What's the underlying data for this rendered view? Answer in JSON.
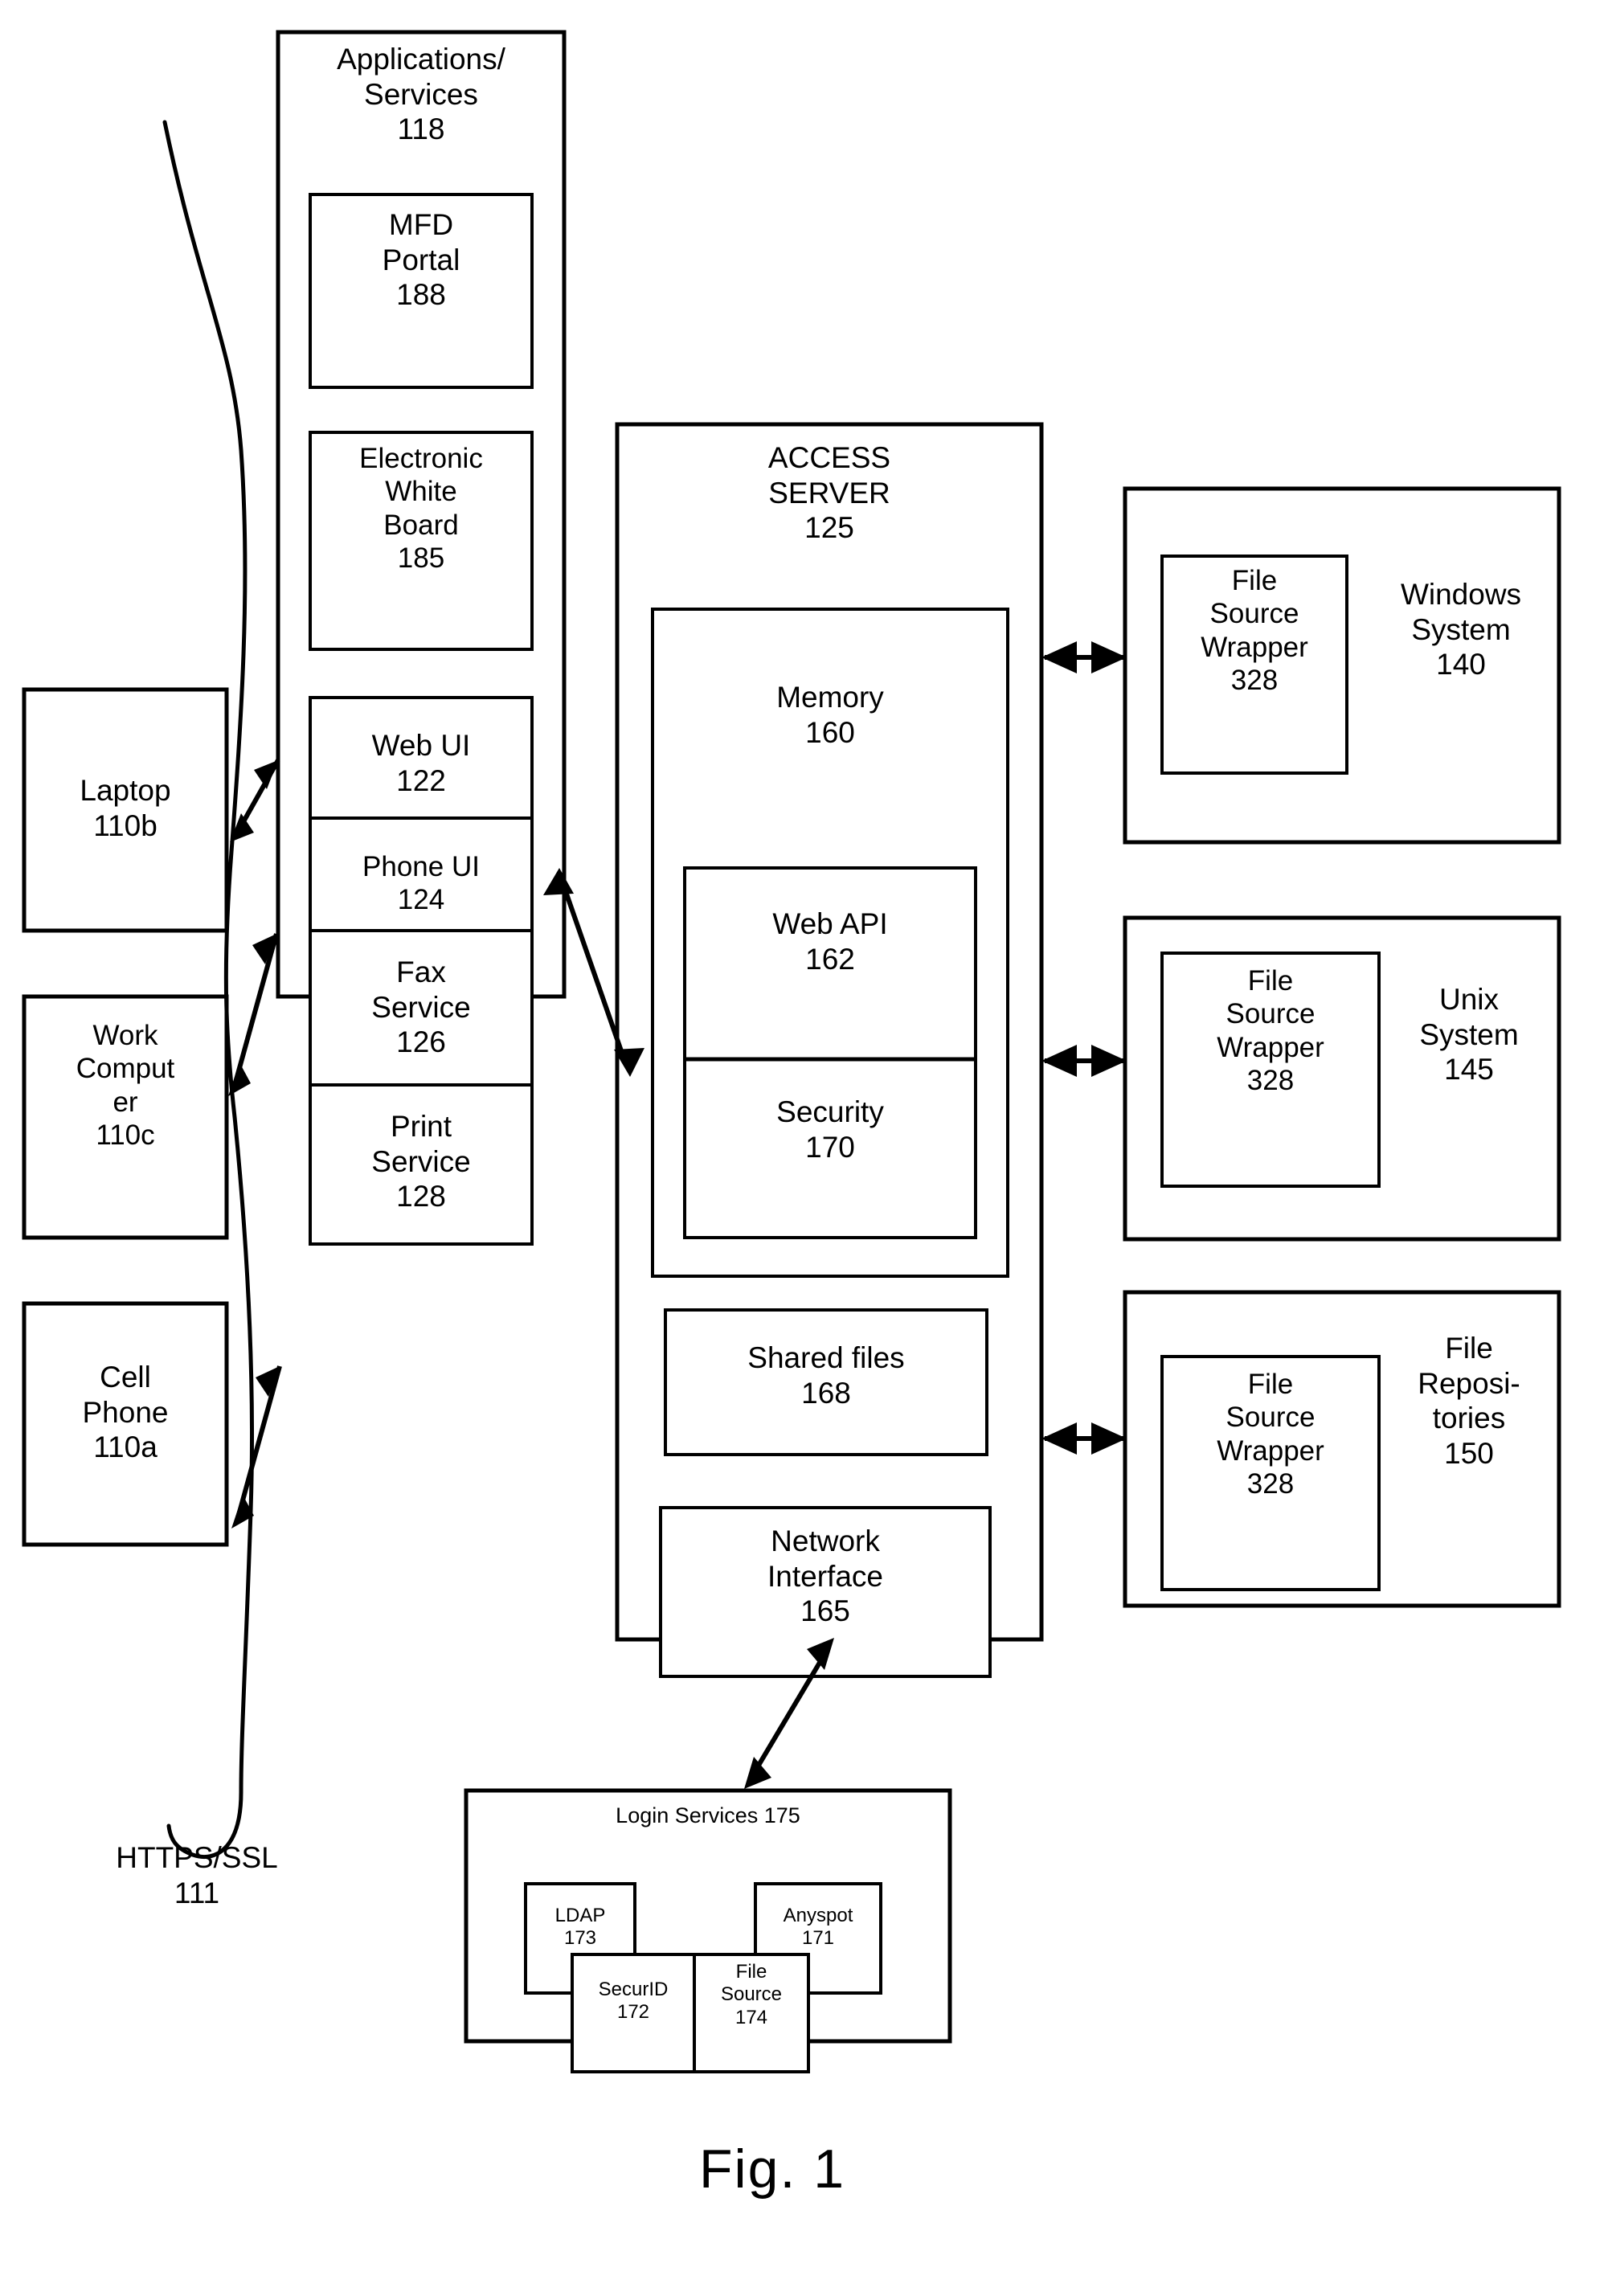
{
  "figure": {
    "caption": "Fig. 1",
    "network_label": "HTTPS/SSL\n111"
  },
  "clients": [
    {
      "id": "laptop",
      "label": "Laptop\n110b"
    },
    {
      "id": "work-computer",
      "label": "Work\nComput\ner\n110c"
    },
    {
      "id": "cell-phone",
      "label": "Cell\nPhone\n110a"
    }
  ],
  "applications_services": {
    "title": "Applications/\nServices\n118",
    "items": [
      {
        "id": "mfd-portal",
        "label": "MFD\nPortal\n188"
      },
      {
        "id": "electronic-white-board",
        "label": "Electronic\nWhite\nBoard\n185"
      },
      {
        "id": "web-ui",
        "label": "Web UI\n122"
      },
      {
        "id": "phone-ui",
        "label": "Phone UI\n124"
      },
      {
        "id": "fax-service",
        "label": "Fax\nService\n126"
      },
      {
        "id": "print-service",
        "label": "Print\nService\n128"
      }
    ]
  },
  "access_server": {
    "title": "ACCESS\nSERVER\n125",
    "memory": {
      "label": "Memory\n160",
      "sub_items": [
        {
          "id": "web-api",
          "label": "Web API\n162"
        },
        {
          "id": "security",
          "label": "Security\n170"
        }
      ]
    },
    "items": [
      {
        "id": "shared-files",
        "label": "Shared files\n168"
      },
      {
        "id": "network-interface",
        "label": "Network\nInterface\n165"
      }
    ]
  },
  "backend_systems": [
    {
      "id": "windows-system",
      "wrapper": "File\nSource\nWrapper\n328",
      "label": "Windows\nSystem\n140"
    },
    {
      "id": "unix-system",
      "wrapper": "File\nSource\nWrapper\n328",
      "label": "Unix\nSystem\n145"
    },
    {
      "id": "file-repositories",
      "wrapper": "File\nSource\nWrapper\n328",
      "label": "File\nReposi-\ntories\n150"
    }
  ],
  "login_services": {
    "title": "Login Services 175",
    "items": [
      {
        "id": "ldap",
        "label": "LDAP\n173"
      },
      {
        "id": "anyspot",
        "label": "Anyspot\n171"
      },
      {
        "id": "securid",
        "label": "SecurID\n172"
      },
      {
        "id": "file-source",
        "label": "File\nSource\n174"
      }
    ]
  },
  "colors": {
    "stroke": "#000000",
    "background": "#ffffff"
  }
}
